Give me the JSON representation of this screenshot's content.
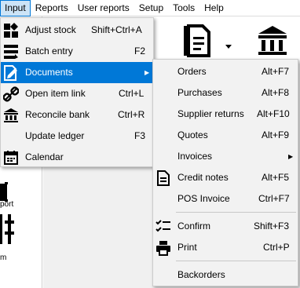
{
  "menubar": {
    "items": [
      "Input",
      "Reports",
      "User reports",
      "Setup",
      "Tools",
      "Help"
    ]
  },
  "background": {
    "left_labels": [
      "port",
      "m"
    ]
  },
  "input_menu": {
    "items": [
      {
        "label": "Adjust stock",
        "shortcut": "Shift+Ctrl+A",
        "icon": "adjust-stock-icon"
      },
      {
        "label": "Batch entry",
        "shortcut": "F2",
        "icon": "batch-entry-icon"
      },
      {
        "label": "Documents",
        "shortcut": "",
        "icon": "documents-icon",
        "submenu": true
      },
      {
        "label": "Open item link",
        "shortcut": "Ctrl+L",
        "icon": "link-icon"
      },
      {
        "label": "Reconcile bank",
        "shortcut": "Ctrl+R",
        "icon": "bank-icon"
      },
      {
        "label": "Update ledger",
        "shortcut": "F3",
        "icon": ""
      },
      {
        "label": "Calendar",
        "shortcut": "",
        "icon": "calendar-icon"
      }
    ]
  },
  "documents_menu": {
    "items": [
      {
        "label": "Orders",
        "shortcut": "Alt+F7",
        "icon": ""
      },
      {
        "label": "Purchases",
        "shortcut": "Alt+F8",
        "icon": ""
      },
      {
        "label": "Supplier returns",
        "shortcut": "Alt+F10",
        "icon": ""
      },
      {
        "label": "Quotes",
        "shortcut": "Alt+F9",
        "icon": ""
      },
      {
        "label": "Invoices",
        "shortcut": "",
        "icon": "",
        "submenu": true
      },
      {
        "label": "Credit notes",
        "shortcut": "Alt+F5",
        "icon": "document-icon"
      },
      {
        "label": "POS Invoice",
        "shortcut": "Ctrl+F7",
        "icon": ""
      },
      {
        "label": "Confirm",
        "shortcut": "Shift+F3",
        "icon": "checklist-icon"
      },
      {
        "label": "Print",
        "shortcut": "Ctrl+P",
        "icon": "printer-icon"
      },
      {
        "label": "Backorders",
        "shortcut": "",
        "icon": ""
      }
    ]
  },
  "colors": {
    "highlight": "#0078d7",
    "menu_bg": "#f2f2f2",
    "menubar_active_bg": "#cce4f7"
  }
}
